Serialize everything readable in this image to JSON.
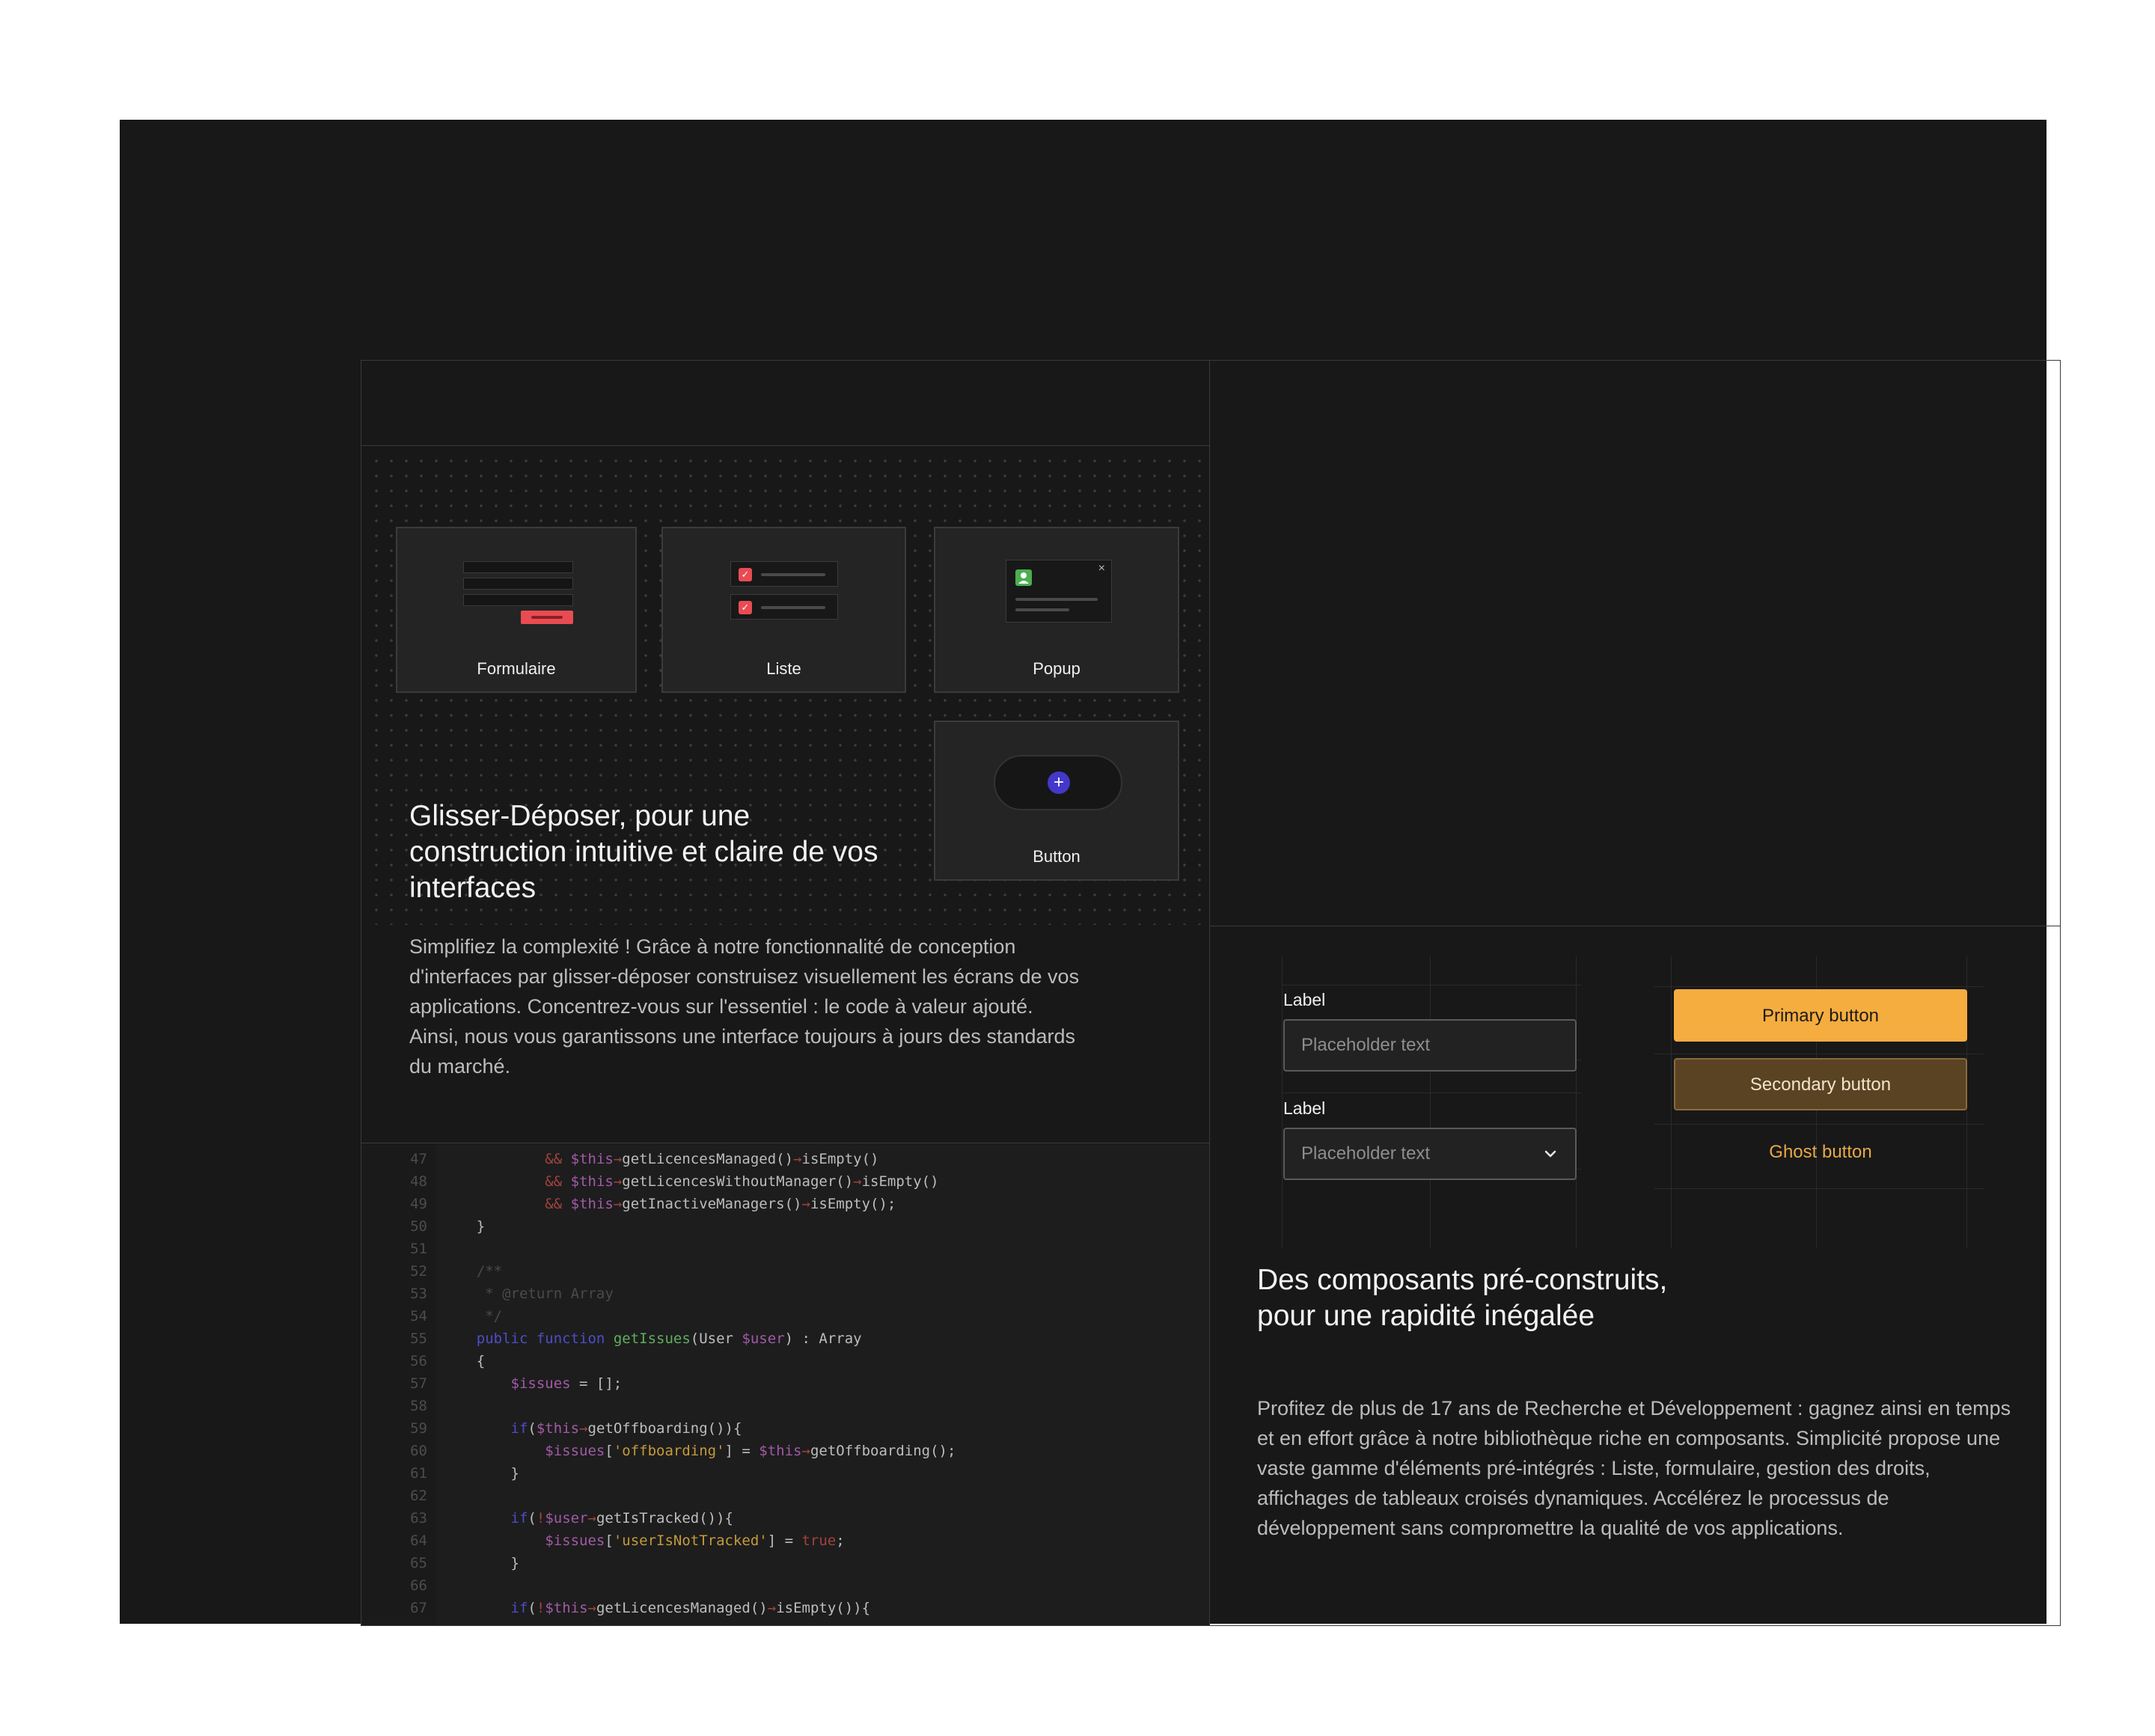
{
  "tiles": {
    "form": "Formulaire",
    "list": "Liste",
    "popup": "Popup",
    "button": "Button",
    "popup_close": "×",
    "button_plus": "+"
  },
  "left_section": {
    "title": "Glisser-Déposer, pour une construction intuitive et claire de vos interfaces",
    "paragraph": "Simplifiez la complexité ! Grâce à notre fonctionnalité de conception d'interfaces par glisser-déposer construisez visuellement les écrans de vos applications. Concentrez-vous sur l'essentiel : le code à valeur ajouté. Ainsi, nous vous garantissons une interface toujours à jours des standards du marché."
  },
  "code": {
    "lines": [
      {
        "n": "47",
        "text": "            && $this→getLicencesManaged()→isEmpty()"
      },
      {
        "n": "48",
        "text": "            && $this→getLicencesWithoutManager()→isEmpty()"
      },
      {
        "n": "49",
        "text": "            && $this→getInactiveManagers()→isEmpty();"
      },
      {
        "n": "50",
        "text": "    }"
      },
      {
        "n": "51",
        "text": ""
      },
      {
        "n": "52",
        "text": "    /**"
      },
      {
        "n": "53",
        "text": "     * @return Array"
      },
      {
        "n": "54",
        "text": "     */"
      },
      {
        "n": "55",
        "text": "    public function getIssues(User $user) : Array"
      },
      {
        "n": "56",
        "text": "    {"
      },
      {
        "n": "57",
        "text": "        $issues = [];"
      },
      {
        "n": "58",
        "text": ""
      },
      {
        "n": "59",
        "text": "        if($this→getOffboarding()){"
      },
      {
        "n": "60",
        "text": "            $issues['offboarding'] = $this→getOffboarding();"
      },
      {
        "n": "61",
        "text": "        }"
      },
      {
        "n": "62",
        "text": ""
      },
      {
        "n": "63",
        "text": "        if(!$user→getIsTracked()){"
      },
      {
        "n": "64",
        "text": "            $issues['userIsNotTracked'] = true;"
      },
      {
        "n": "65",
        "text": "        }"
      },
      {
        "n": "66",
        "text": ""
      },
      {
        "n": "67",
        "text": "        if(!$this→getLicencesManaged()→isEmpty()){"
      }
    ]
  },
  "components": {
    "field1_label": "Label",
    "field1_placeholder": "Placeholder text",
    "field2_label": "Label",
    "field2_placeholder": "Placeholder text",
    "primary_button": "Primary button",
    "secondary_button": "Secondary button",
    "ghost_button": "Ghost button"
  },
  "right_section": {
    "title_line1": "Des composants pré-construits,",
    "title_line2": "pour une rapidité inégalée",
    "paragraph": "Profitez de plus de 17 ans de Recherche et Développement : gagnez ainsi en temps et en effort grâce à notre bibliothèque riche en composants. Simplicité propose une vaste gamme d'éléments pré-intégrés : Liste, formulaire, gestion des droits, affichages de tableaux croisés dynamiques. Accélérez le processus de développement sans compromettre la qualité de vos applications."
  },
  "colors": {
    "frame_bg": "#181818",
    "accent_red": "#e94b52",
    "accent_green": "#4caf50",
    "accent_blue": "#4338ca",
    "primary_orange": "#f5ad3f",
    "secondary_brown": "#5a4323"
  },
  "icons": {
    "popup_avatar": "person-icon",
    "button_plus": "plus-circle-icon",
    "select_chevron": "chevron-down-icon",
    "checkbox": "check-icon"
  }
}
